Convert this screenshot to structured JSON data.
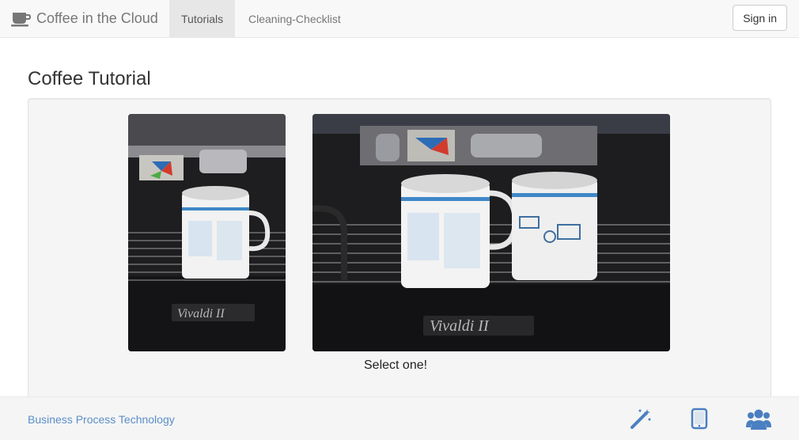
{
  "navbar": {
    "brand": "Coffee in the Cloud",
    "brand_icon": "coffee-cup-icon",
    "items": [
      {
        "label": "Tutorials",
        "active": true
      },
      {
        "label": "Cleaning-Checklist",
        "active": false
      }
    ],
    "signin_label": "Sign in"
  },
  "main": {
    "title": "Coffee Tutorial",
    "images": [
      {
        "name": "single-cup-photo",
        "description_icon": "photo"
      },
      {
        "name": "two-cups-photo",
        "description_icon": "photo"
      }
    ],
    "caption": "Select one!"
  },
  "footer": {
    "link": "Business Process Technology",
    "icons": [
      "magic-wand-icon",
      "tablet-icon",
      "users-icon"
    ],
    "icon_color": "#4a7fc1"
  },
  "colors": {
    "navbar_bg": "#f8f8f8",
    "active_tab_bg": "#e7e7e7",
    "well_bg": "#f5f5f5",
    "link": "#5b8ec9"
  }
}
